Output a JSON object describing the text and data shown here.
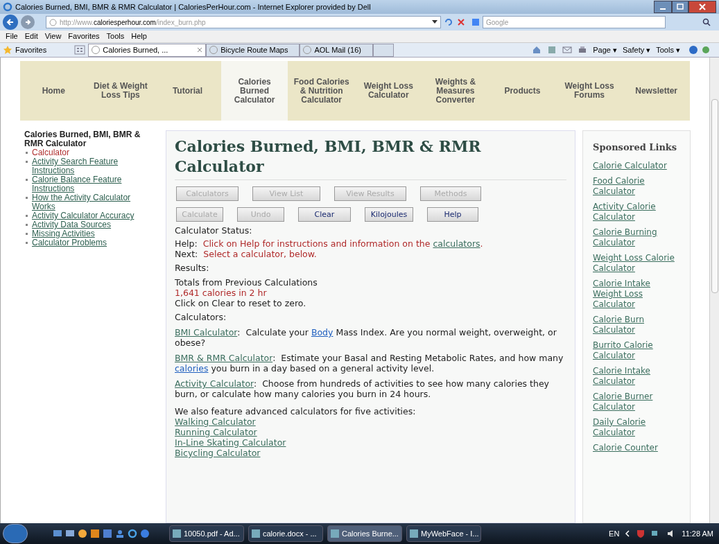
{
  "window": {
    "title": "Calories Burned, BMI, BMR & RMR Calculator | CaloriesPerHour.com - Internet Explorer provided by Dell"
  },
  "address_bar": {
    "url_prefix": "http://www.",
    "url_domain": "caloriesperhour.com",
    "url_path": "/index_burn.php",
    "search_placeholder": "Google"
  },
  "menu": [
    "File",
    "Edit",
    "View",
    "Favorites",
    "Tools",
    "Help"
  ],
  "favorites_bar": {
    "favorites": "Favorites",
    "tabs": [
      {
        "label": "Calories Burned, ...",
        "selected": true
      },
      {
        "label": "Bicycle Route Maps",
        "selected": false
      },
      {
        "label": "AOL Mail (16)",
        "selected": false
      }
    ],
    "commands": [
      "Page ▾",
      "Safety ▾",
      "Tools ▾"
    ]
  },
  "nav": [
    {
      "label": "Home",
      "selected": false
    },
    {
      "label": "Diet & Weight Loss Tips",
      "selected": false
    },
    {
      "label": "Tutorial",
      "selected": false
    },
    {
      "label": "Calories Burned Calculator",
      "selected": true
    },
    {
      "label": "Food Calories & Nutrition Calculator",
      "selected": false
    },
    {
      "label": "Weight Loss Calculator",
      "selected": false
    },
    {
      "label": "Weights & Measures Converter",
      "selected": false
    },
    {
      "label": "Products",
      "selected": false
    },
    {
      "label": "Weight Loss Forums",
      "selected": false
    },
    {
      "label": "Newsletter",
      "selected": false
    }
  ],
  "sidebar": {
    "title": "Calories Burned, BMI, BMR & RMR Calculator",
    "items": [
      {
        "label": "Calculator",
        "selected": true
      },
      {
        "label": "Activity Search Feature Instructions",
        "selected": false
      },
      {
        "label": "Calorie Balance Feature Instructions",
        "selected": false
      },
      {
        "label": "How the Activity Calculator Works",
        "selected": false
      },
      {
        "label": "Activity Calculator Accuracy",
        "selected": false
      },
      {
        "label": "Activity Data Sources",
        "selected": false
      },
      {
        "label": "Missing Activities",
        "selected": false
      },
      {
        "label": "Calculator Problems",
        "selected": false
      }
    ]
  },
  "main": {
    "heading": "Calories Burned, BMI, BMR & RMR Calculator",
    "button_rows": [
      [
        {
          "label": "Calculators",
          "disabled": true
        },
        {
          "label": "View List",
          "disabled": true
        },
        {
          "label": "View Results",
          "disabled": true
        },
        {
          "label": "Methods",
          "disabled": true
        }
      ],
      [
        {
          "label": "Calculate",
          "disabled": true
        },
        {
          "label": "Undo",
          "disabled": true
        },
        {
          "label": "Clear",
          "disabled": false
        },
        {
          "label": "Kilojoules",
          "disabled": false
        },
        {
          "label": "Help",
          "disabled": false
        }
      ]
    ],
    "status_label": "Calculator Status:",
    "help": {
      "label": "Help:",
      "segments": [
        {
          "kind": "text",
          "text": "Click on Help for instructions and information on the "
        },
        {
          "kind": "link",
          "text": "calculators"
        },
        {
          "kind": "text",
          "text": "."
        }
      ]
    },
    "next": {
      "label": "Next:",
      "text": "Select a calculator, below."
    },
    "results_label": "Results:",
    "totals_title": "Totals from Previous Calculations",
    "totals_value": "1,641 calories in 2 hr",
    "totals_note": "Click on Clear to reset to zero.",
    "calculators_label": "Calculators:",
    "calculators": [
      [
        {
          "kind": "link",
          "text": "BMI Calculator"
        },
        {
          "kind": "text",
          "text": ":  Calculate your "
        },
        {
          "kind": "bluelink",
          "text": "Body"
        },
        {
          "kind": "text",
          "text": " Mass Index. Are you normal weight, overweight, or obese?"
        }
      ],
      [
        {
          "kind": "link",
          "text": "BMR & RMR Calculator"
        },
        {
          "kind": "text",
          "text": ":  Estimate your Basal and Resting Metabolic Rates, and how many "
        },
        {
          "kind": "bluelink",
          "text": "calories"
        },
        {
          "kind": "text",
          "text": " you burn in a day based on a general activity level."
        }
      ],
      [
        {
          "kind": "link",
          "text": "Activity Calculator"
        },
        {
          "kind": "text",
          "text": ":  Choose from hundreds of activities to see how many calories they burn, or calculate how many calories you burn in 24 hours."
        }
      ]
    ],
    "advanced_intro": "We also feature advanced calculators for five activities:",
    "advanced": [
      "Walking Calculator",
      "Running Calculator",
      "In-Line Skating Calculator",
      "Bicycling Calculator"
    ]
  },
  "sponsored": {
    "title": "Sponsored Links",
    "links": [
      "Calorie Calculator",
      "Food Calorie Calculator",
      "Activity Calorie Calculator",
      "Calorie Burning Calculator",
      "Weight Loss Calorie Calculator",
      "Calorie Intake Weight Loss Calculator",
      "Calorie Burn Calculator",
      "Burrito Calorie Calculator",
      "Calorie Intake Calculator",
      "Calorie Burner Calculator",
      "Daily Calorie Calculator",
      "Calorie Counter"
    ]
  },
  "taskbar": {
    "tasks": [
      {
        "label": "10050.pdf - Ad...",
        "selected": false
      },
      {
        "label": "calorie.docx - ...",
        "selected": false
      },
      {
        "label": "Calories Burne...",
        "selected": true
      },
      {
        "label": "MyWebFace - I...",
        "selected": false
      }
    ],
    "language": "EN",
    "time": "11:28 AM"
  }
}
